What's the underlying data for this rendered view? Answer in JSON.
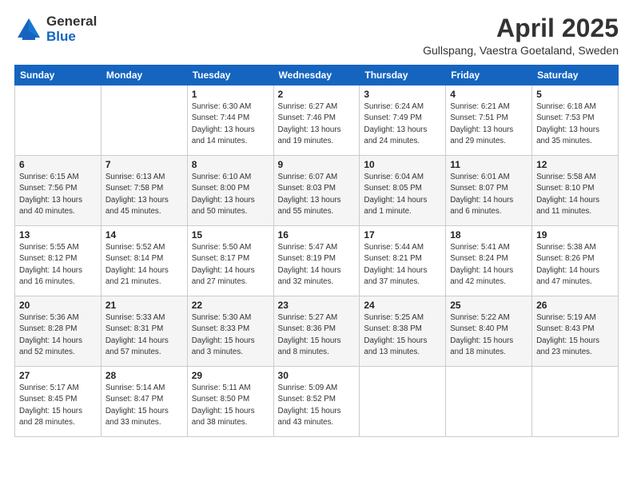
{
  "header": {
    "logo_general": "General",
    "logo_blue": "Blue",
    "title": "April 2025",
    "subtitle": "Gullspang, Vaestra Goetaland, Sweden"
  },
  "days_of_week": [
    "Sunday",
    "Monday",
    "Tuesday",
    "Wednesday",
    "Thursday",
    "Friday",
    "Saturday"
  ],
  "weeks": [
    [
      {
        "day": "",
        "info": ""
      },
      {
        "day": "",
        "info": ""
      },
      {
        "day": "1",
        "info": "Sunrise: 6:30 AM\nSunset: 7:44 PM\nDaylight: 13 hours\nand 14 minutes."
      },
      {
        "day": "2",
        "info": "Sunrise: 6:27 AM\nSunset: 7:46 PM\nDaylight: 13 hours\nand 19 minutes."
      },
      {
        "day": "3",
        "info": "Sunrise: 6:24 AM\nSunset: 7:49 PM\nDaylight: 13 hours\nand 24 minutes."
      },
      {
        "day": "4",
        "info": "Sunrise: 6:21 AM\nSunset: 7:51 PM\nDaylight: 13 hours\nand 29 minutes."
      },
      {
        "day": "5",
        "info": "Sunrise: 6:18 AM\nSunset: 7:53 PM\nDaylight: 13 hours\nand 35 minutes."
      }
    ],
    [
      {
        "day": "6",
        "info": "Sunrise: 6:15 AM\nSunset: 7:56 PM\nDaylight: 13 hours\nand 40 minutes."
      },
      {
        "day": "7",
        "info": "Sunrise: 6:13 AM\nSunset: 7:58 PM\nDaylight: 13 hours\nand 45 minutes."
      },
      {
        "day": "8",
        "info": "Sunrise: 6:10 AM\nSunset: 8:00 PM\nDaylight: 13 hours\nand 50 minutes."
      },
      {
        "day": "9",
        "info": "Sunrise: 6:07 AM\nSunset: 8:03 PM\nDaylight: 13 hours\nand 55 minutes."
      },
      {
        "day": "10",
        "info": "Sunrise: 6:04 AM\nSunset: 8:05 PM\nDaylight: 14 hours\nand 1 minute."
      },
      {
        "day": "11",
        "info": "Sunrise: 6:01 AM\nSunset: 8:07 PM\nDaylight: 14 hours\nand 6 minutes."
      },
      {
        "day": "12",
        "info": "Sunrise: 5:58 AM\nSunset: 8:10 PM\nDaylight: 14 hours\nand 11 minutes."
      }
    ],
    [
      {
        "day": "13",
        "info": "Sunrise: 5:55 AM\nSunset: 8:12 PM\nDaylight: 14 hours\nand 16 minutes."
      },
      {
        "day": "14",
        "info": "Sunrise: 5:52 AM\nSunset: 8:14 PM\nDaylight: 14 hours\nand 21 minutes."
      },
      {
        "day": "15",
        "info": "Sunrise: 5:50 AM\nSunset: 8:17 PM\nDaylight: 14 hours\nand 27 minutes."
      },
      {
        "day": "16",
        "info": "Sunrise: 5:47 AM\nSunset: 8:19 PM\nDaylight: 14 hours\nand 32 minutes."
      },
      {
        "day": "17",
        "info": "Sunrise: 5:44 AM\nSunset: 8:21 PM\nDaylight: 14 hours\nand 37 minutes."
      },
      {
        "day": "18",
        "info": "Sunrise: 5:41 AM\nSunset: 8:24 PM\nDaylight: 14 hours\nand 42 minutes."
      },
      {
        "day": "19",
        "info": "Sunrise: 5:38 AM\nSunset: 8:26 PM\nDaylight: 14 hours\nand 47 minutes."
      }
    ],
    [
      {
        "day": "20",
        "info": "Sunrise: 5:36 AM\nSunset: 8:28 PM\nDaylight: 14 hours\nand 52 minutes."
      },
      {
        "day": "21",
        "info": "Sunrise: 5:33 AM\nSunset: 8:31 PM\nDaylight: 14 hours\nand 57 minutes."
      },
      {
        "day": "22",
        "info": "Sunrise: 5:30 AM\nSunset: 8:33 PM\nDaylight: 15 hours\nand 3 minutes."
      },
      {
        "day": "23",
        "info": "Sunrise: 5:27 AM\nSunset: 8:36 PM\nDaylight: 15 hours\nand 8 minutes."
      },
      {
        "day": "24",
        "info": "Sunrise: 5:25 AM\nSunset: 8:38 PM\nDaylight: 15 hours\nand 13 minutes."
      },
      {
        "day": "25",
        "info": "Sunrise: 5:22 AM\nSunset: 8:40 PM\nDaylight: 15 hours\nand 18 minutes."
      },
      {
        "day": "26",
        "info": "Sunrise: 5:19 AM\nSunset: 8:43 PM\nDaylight: 15 hours\nand 23 minutes."
      }
    ],
    [
      {
        "day": "27",
        "info": "Sunrise: 5:17 AM\nSunset: 8:45 PM\nDaylight: 15 hours\nand 28 minutes."
      },
      {
        "day": "28",
        "info": "Sunrise: 5:14 AM\nSunset: 8:47 PM\nDaylight: 15 hours\nand 33 minutes."
      },
      {
        "day": "29",
        "info": "Sunrise: 5:11 AM\nSunset: 8:50 PM\nDaylight: 15 hours\nand 38 minutes."
      },
      {
        "day": "30",
        "info": "Sunrise: 5:09 AM\nSunset: 8:52 PM\nDaylight: 15 hours\nand 43 minutes."
      },
      {
        "day": "",
        "info": ""
      },
      {
        "day": "",
        "info": ""
      },
      {
        "day": "",
        "info": ""
      }
    ]
  ]
}
